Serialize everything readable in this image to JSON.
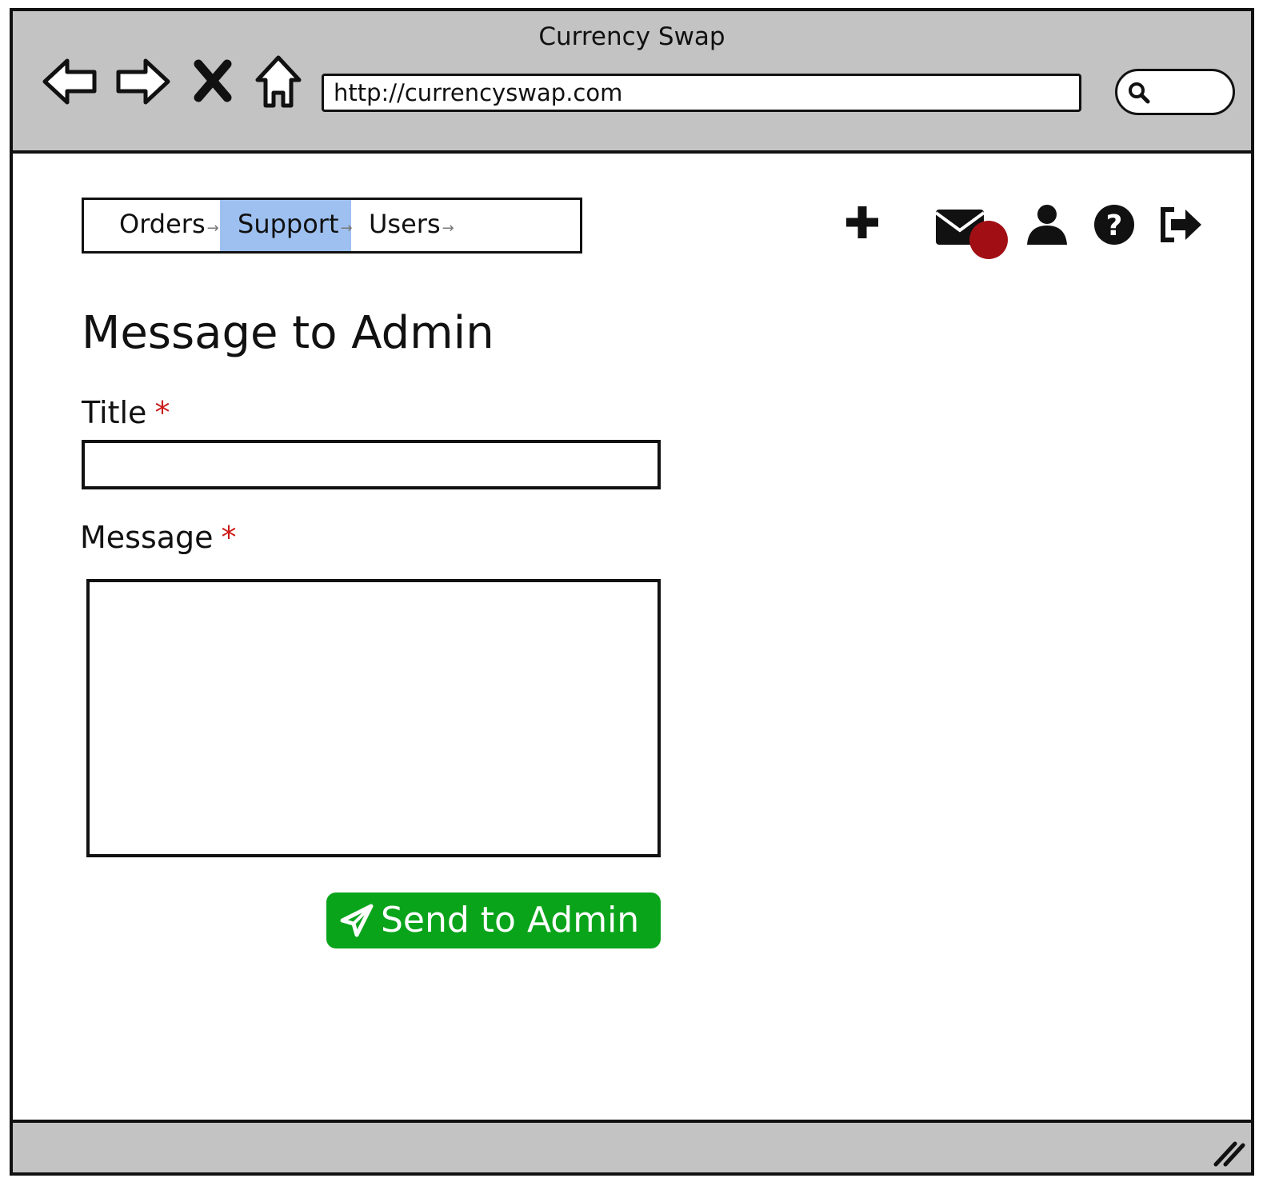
{
  "window": {
    "title": "Currency Swap"
  },
  "browser": {
    "url": "http://currencyswap.com",
    "nav_icons": [
      "back-arrow-icon",
      "forward-arrow-icon",
      "stop-icon",
      "home-icon"
    ],
    "search_icon": "search-icon"
  },
  "tabs": [
    {
      "label": "Orders",
      "active": false
    },
    {
      "label": "Support",
      "active": true
    },
    {
      "label": "Users",
      "active": false
    }
  ],
  "header_icons": [
    "plus-icon",
    "envelope-icon",
    "user-icon",
    "help-icon",
    "logout-icon"
  ],
  "page": {
    "title": "Message to Admin",
    "title_field_label": "Title",
    "message_field_label": "Message",
    "required_marker": "*",
    "submit_label": "Send to Admin"
  },
  "colors": {
    "chrome": "#c3c3c3",
    "active_tab": "#9ec0f0",
    "submit": "#0aa41b",
    "required": "#cc1a1a",
    "badge": "#a10f14"
  }
}
